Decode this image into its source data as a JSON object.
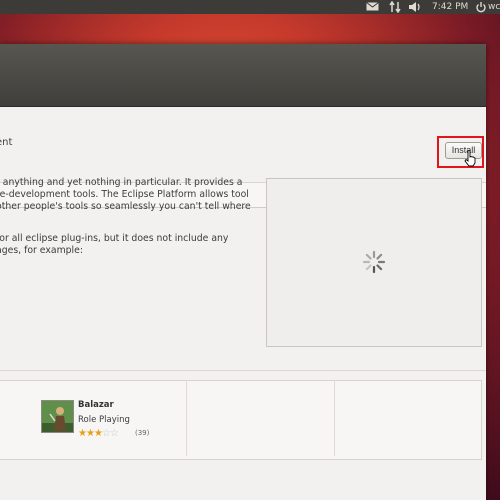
{
  "top_panel": {
    "icons": [
      "mail-icon",
      "network-icon",
      "volume-icon",
      "power-icon"
    ],
    "clock": "7:42 PM",
    "user": "wc"
  },
  "window": {
    "status_fragment": "ent",
    "install_button_label": "Install",
    "description_paragraph_1": [
      "r anything and yet nothing in particular. It provides a",
      "re-development tools. The Eclipse Platform allows tool",
      "other people's tools so seamlessly you can't tell where"
    ],
    "description_paragraph_2": [
      "for all eclipse plug-ins, but it does not include any",
      "ages, for example:"
    ],
    "screenshot_state": "loading"
  },
  "recommended_apps": [
    {
      "name": "Balazar",
      "genre": "Role Playing",
      "rating": 2.5,
      "rating_max": 5,
      "rating_count": "(39)"
    }
  ],
  "colors": {
    "highlight_box": "#e0161b",
    "star_on": "#e8a018",
    "titlebar": "#4a4945"
  }
}
